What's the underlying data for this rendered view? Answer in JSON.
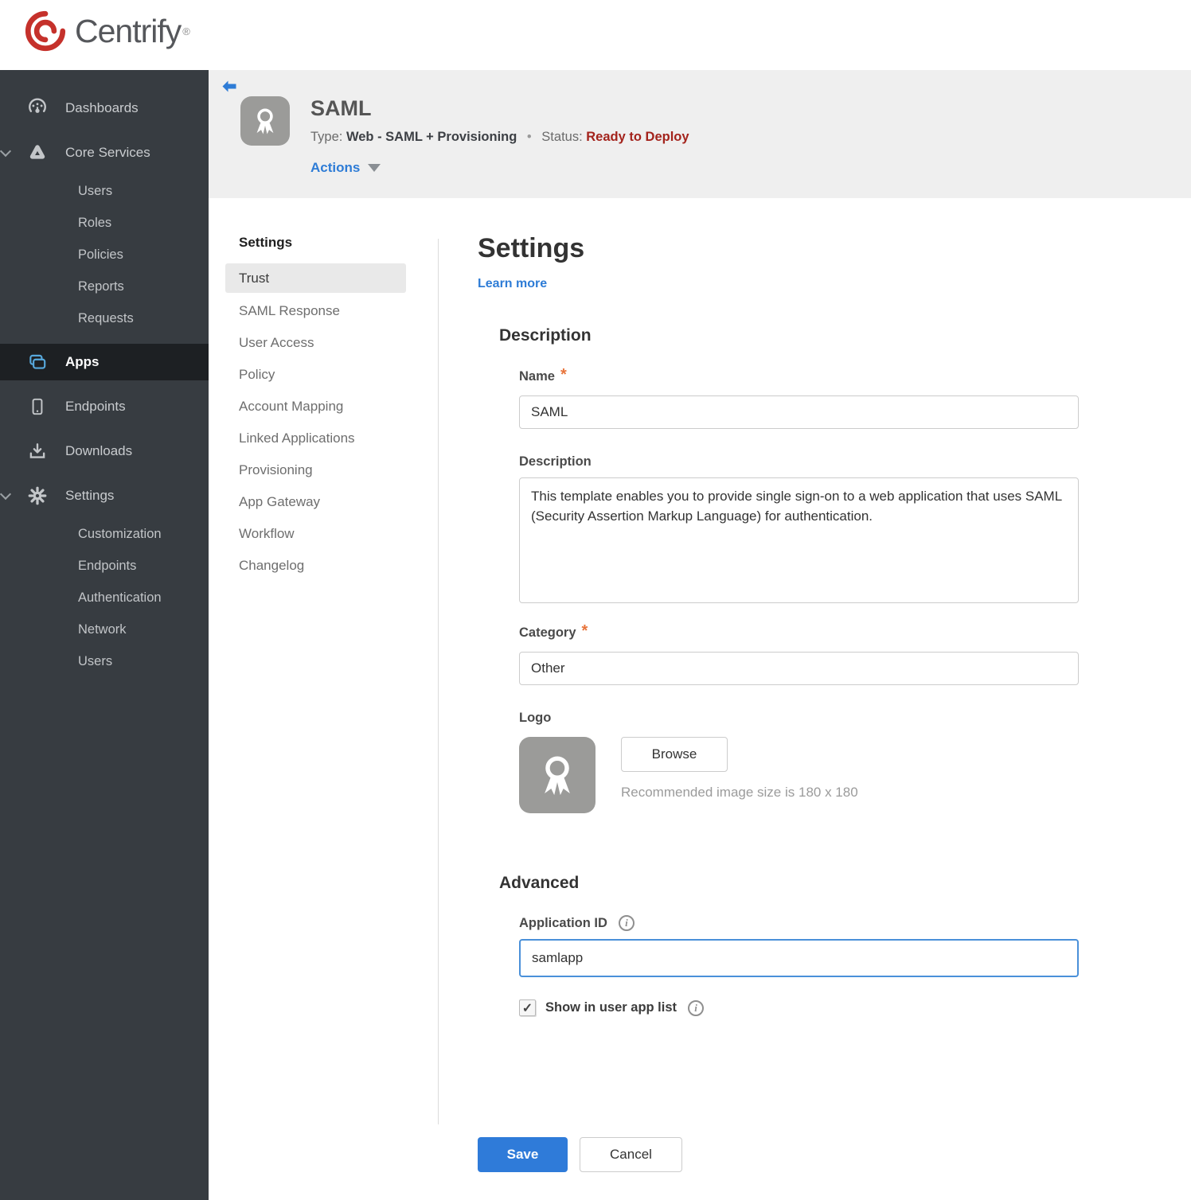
{
  "brand": {
    "name": "Centrify",
    "registered": "®"
  },
  "sidebar": {
    "dashboards": "Dashboards",
    "core_services": "Core Services",
    "core_children": [
      "Users",
      "Roles",
      "Policies",
      "Reports",
      "Requests"
    ],
    "apps": "Apps",
    "endpoints": "Endpoints",
    "downloads": "Downloads",
    "settings": "Settings",
    "settings_children": [
      "Customization",
      "Endpoints",
      "Authentication",
      "Network",
      "Users"
    ]
  },
  "app_header": {
    "title": "SAML",
    "type_label": "Type:",
    "type_value": "Web - SAML + Provisioning",
    "separator": "•",
    "status_label": "Status:",
    "status_value": "Ready to Deploy",
    "actions_label": "Actions"
  },
  "subnav": {
    "heading": "Settings",
    "items": [
      "Trust",
      "SAML Response",
      "User Access",
      "Policy",
      "Account Mapping",
      "Linked Applications",
      "Provisioning",
      "App Gateway",
      "Workflow",
      "Changelog"
    ],
    "active_item": "Trust"
  },
  "form": {
    "title": "Settings",
    "learn_more": "Learn more",
    "description_section": "Description",
    "name_label": "Name",
    "name_value": "SAML",
    "description_label": "Description",
    "description_value": "This template enables you to provide single sign-on to a web application that uses SAML (Security Assertion Markup Language) for authentication.",
    "category_label": "Category",
    "category_value": "Other",
    "logo_label": "Logo",
    "browse_label": "Browse",
    "logo_hint": "Recommended image size is 180 x 180",
    "advanced_section": "Advanced",
    "app_id_label": "Application ID",
    "app_id_value": "samlapp",
    "show_in_app_list_label": "Show in user app list",
    "save_label": "Save",
    "cancel_label": "Cancel"
  },
  "icons": {
    "required_marker": "*",
    "info": "i",
    "check": "✓"
  },
  "colors": {
    "accent_blue": "#2e7cd6",
    "save_blue": "#2f7bd9",
    "status_red": "#a3231c",
    "brand_red": "#c5312b",
    "sidebar_bg": "#373c41",
    "sidebar_active_bg": "#1d2023",
    "header_bg": "#efefef",
    "apps_icon_blue": "#57a8dc"
  }
}
